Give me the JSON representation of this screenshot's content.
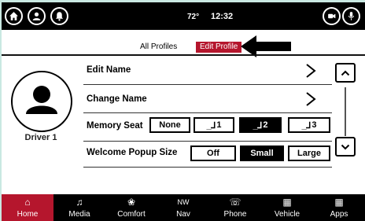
{
  "status_bar": {
    "temperature": "72°",
    "time": "12:32"
  },
  "tabs": {
    "all_profiles": "All Profiles",
    "edit_profile": "Edit Profile"
  },
  "profile": {
    "driver_label": "Driver 1"
  },
  "rows": {
    "edit_name": "Edit Name",
    "change_name": "Change Name",
    "memory_seat": {
      "label": "Memory Seat",
      "options": [
        "None",
        "1",
        "2",
        "3"
      ],
      "selected": "2"
    },
    "welcome_popup": {
      "label": "Welcome Popup Size",
      "options": [
        "Off",
        "Small",
        "Large"
      ],
      "selected": "Small"
    }
  },
  "nav": {
    "items": [
      {
        "label": "Home",
        "icon": "home-icon"
      },
      {
        "label": "Media",
        "icon": "music-note-icon"
      },
      {
        "label": "Comfort",
        "icon": "climate-icon"
      },
      {
        "label": "Nav",
        "icon": "compass-icon",
        "glyph": "NW"
      },
      {
        "label": "Phone",
        "icon": "phone-icon"
      },
      {
        "label": "Vehicle",
        "icon": "car-icon"
      },
      {
        "label": "Apps",
        "icon": "apps-grid-icon"
      }
    ],
    "active": "Home"
  },
  "colors": {
    "accent": "#b5162d",
    "bar": "#000000",
    "background": "#ffffff"
  }
}
